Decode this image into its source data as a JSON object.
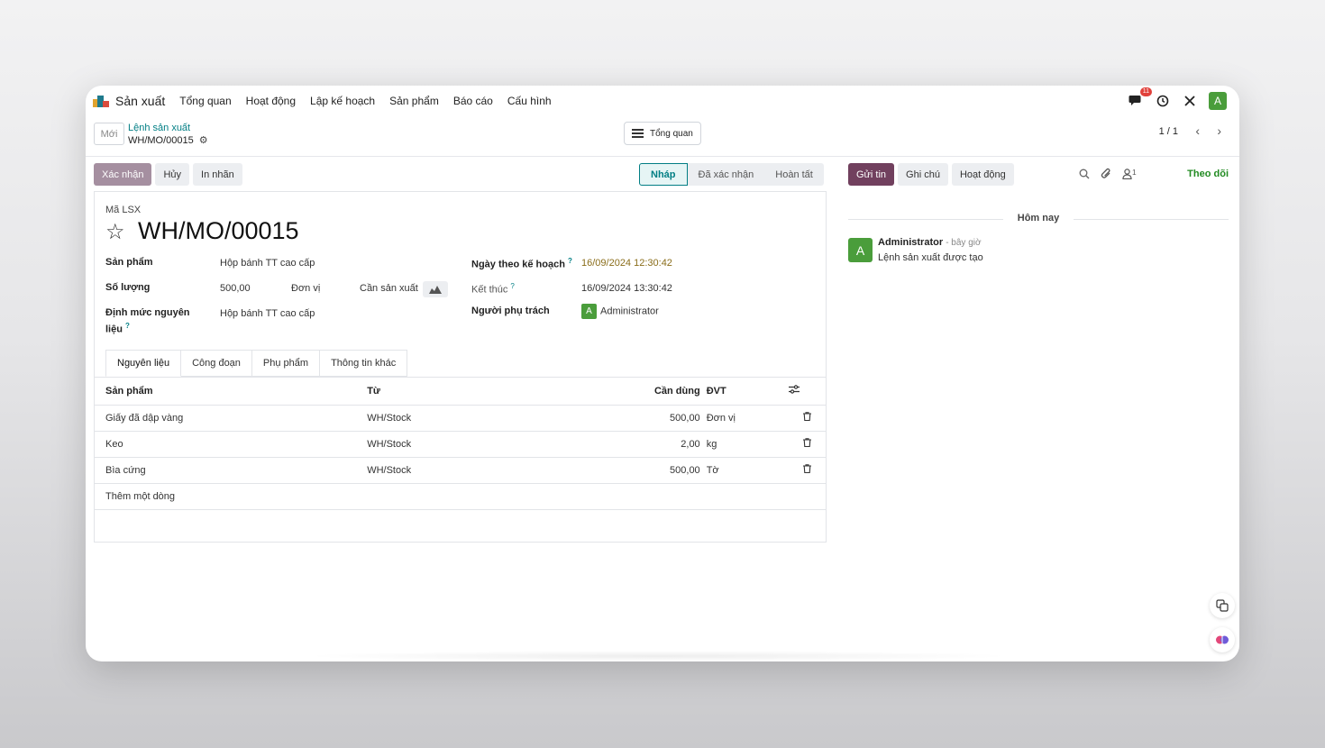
{
  "nav": {
    "app_name": "Sản xuất",
    "items": [
      "Tổng quan",
      "Hoạt động",
      "Lập kế hoạch",
      "Sản phẩm",
      "Báo cáo",
      "Cấu hình"
    ],
    "message_badge": "11",
    "user_initial": "A"
  },
  "control": {
    "new_label": "Mới",
    "breadcrumb_parent": "Lệnh sản xuất",
    "breadcrumb_current": "WH/MO/00015",
    "overview_label": "Tổng quan",
    "pager": "1 / 1"
  },
  "actions": {
    "confirm": "Xác nhận",
    "cancel": "Hủy",
    "print_label": "In nhãn"
  },
  "status": {
    "steps": [
      "Nháp",
      "Đã xác nhận",
      "Hoàn tất"
    ],
    "active": "Nháp"
  },
  "form": {
    "ref_label": "Mã LSX",
    "title": "WH/MO/00015",
    "product_label": "Sản phẩm",
    "product_value": "Hộp bánh TT cao cấp",
    "qty_label": "Số lượng",
    "qty_value": "500,00",
    "uom_value": "Đơn vị",
    "to_produce_label": "Cần sản xuất",
    "bom_label_1": "Định mức nguyên",
    "bom_label_2": "liệu",
    "bom_value": "Hộp bánh TT cao cấp",
    "planned_label": "Ngày theo kế hoạch",
    "planned_value": "16/09/2024 12:30:42",
    "end_label": "Kết thúc",
    "end_value": "16/09/2024 13:30:42",
    "responsible_label": "Người phụ trách",
    "responsible_initial": "A",
    "responsible_value": "Administrator",
    "help_mark": "?"
  },
  "tabs": [
    "Nguyên liệu",
    "Công đoạn",
    "Phụ phẩm",
    "Thông tin khác"
  ],
  "lines": {
    "headers": [
      "Sản phẩm",
      "Từ",
      "Cần dùng",
      "ĐVT"
    ],
    "rows": [
      {
        "product": "Giấy đã dập vàng",
        "from": "WH/Stock",
        "qty": "500,00",
        "uom": "Đơn vị"
      },
      {
        "product": "Keo",
        "from": "WH/Stock",
        "qty": "2,00",
        "uom": "kg"
      },
      {
        "product": "Bìa cứng",
        "from": "WH/Stock",
        "qty": "500,00",
        "uom": "Tờ"
      }
    ],
    "add_line": "Thêm một dòng"
  },
  "chatter": {
    "send": "Gửi tin",
    "note": "Ghi chú",
    "activity": "Hoạt động",
    "follower_count": "1",
    "follow": "Theo dõi",
    "today": "Hôm nay",
    "author": "Administrator",
    "time": "- bây giờ",
    "author_initial": "A",
    "message": "Lệnh sản xuất được tạo"
  }
}
